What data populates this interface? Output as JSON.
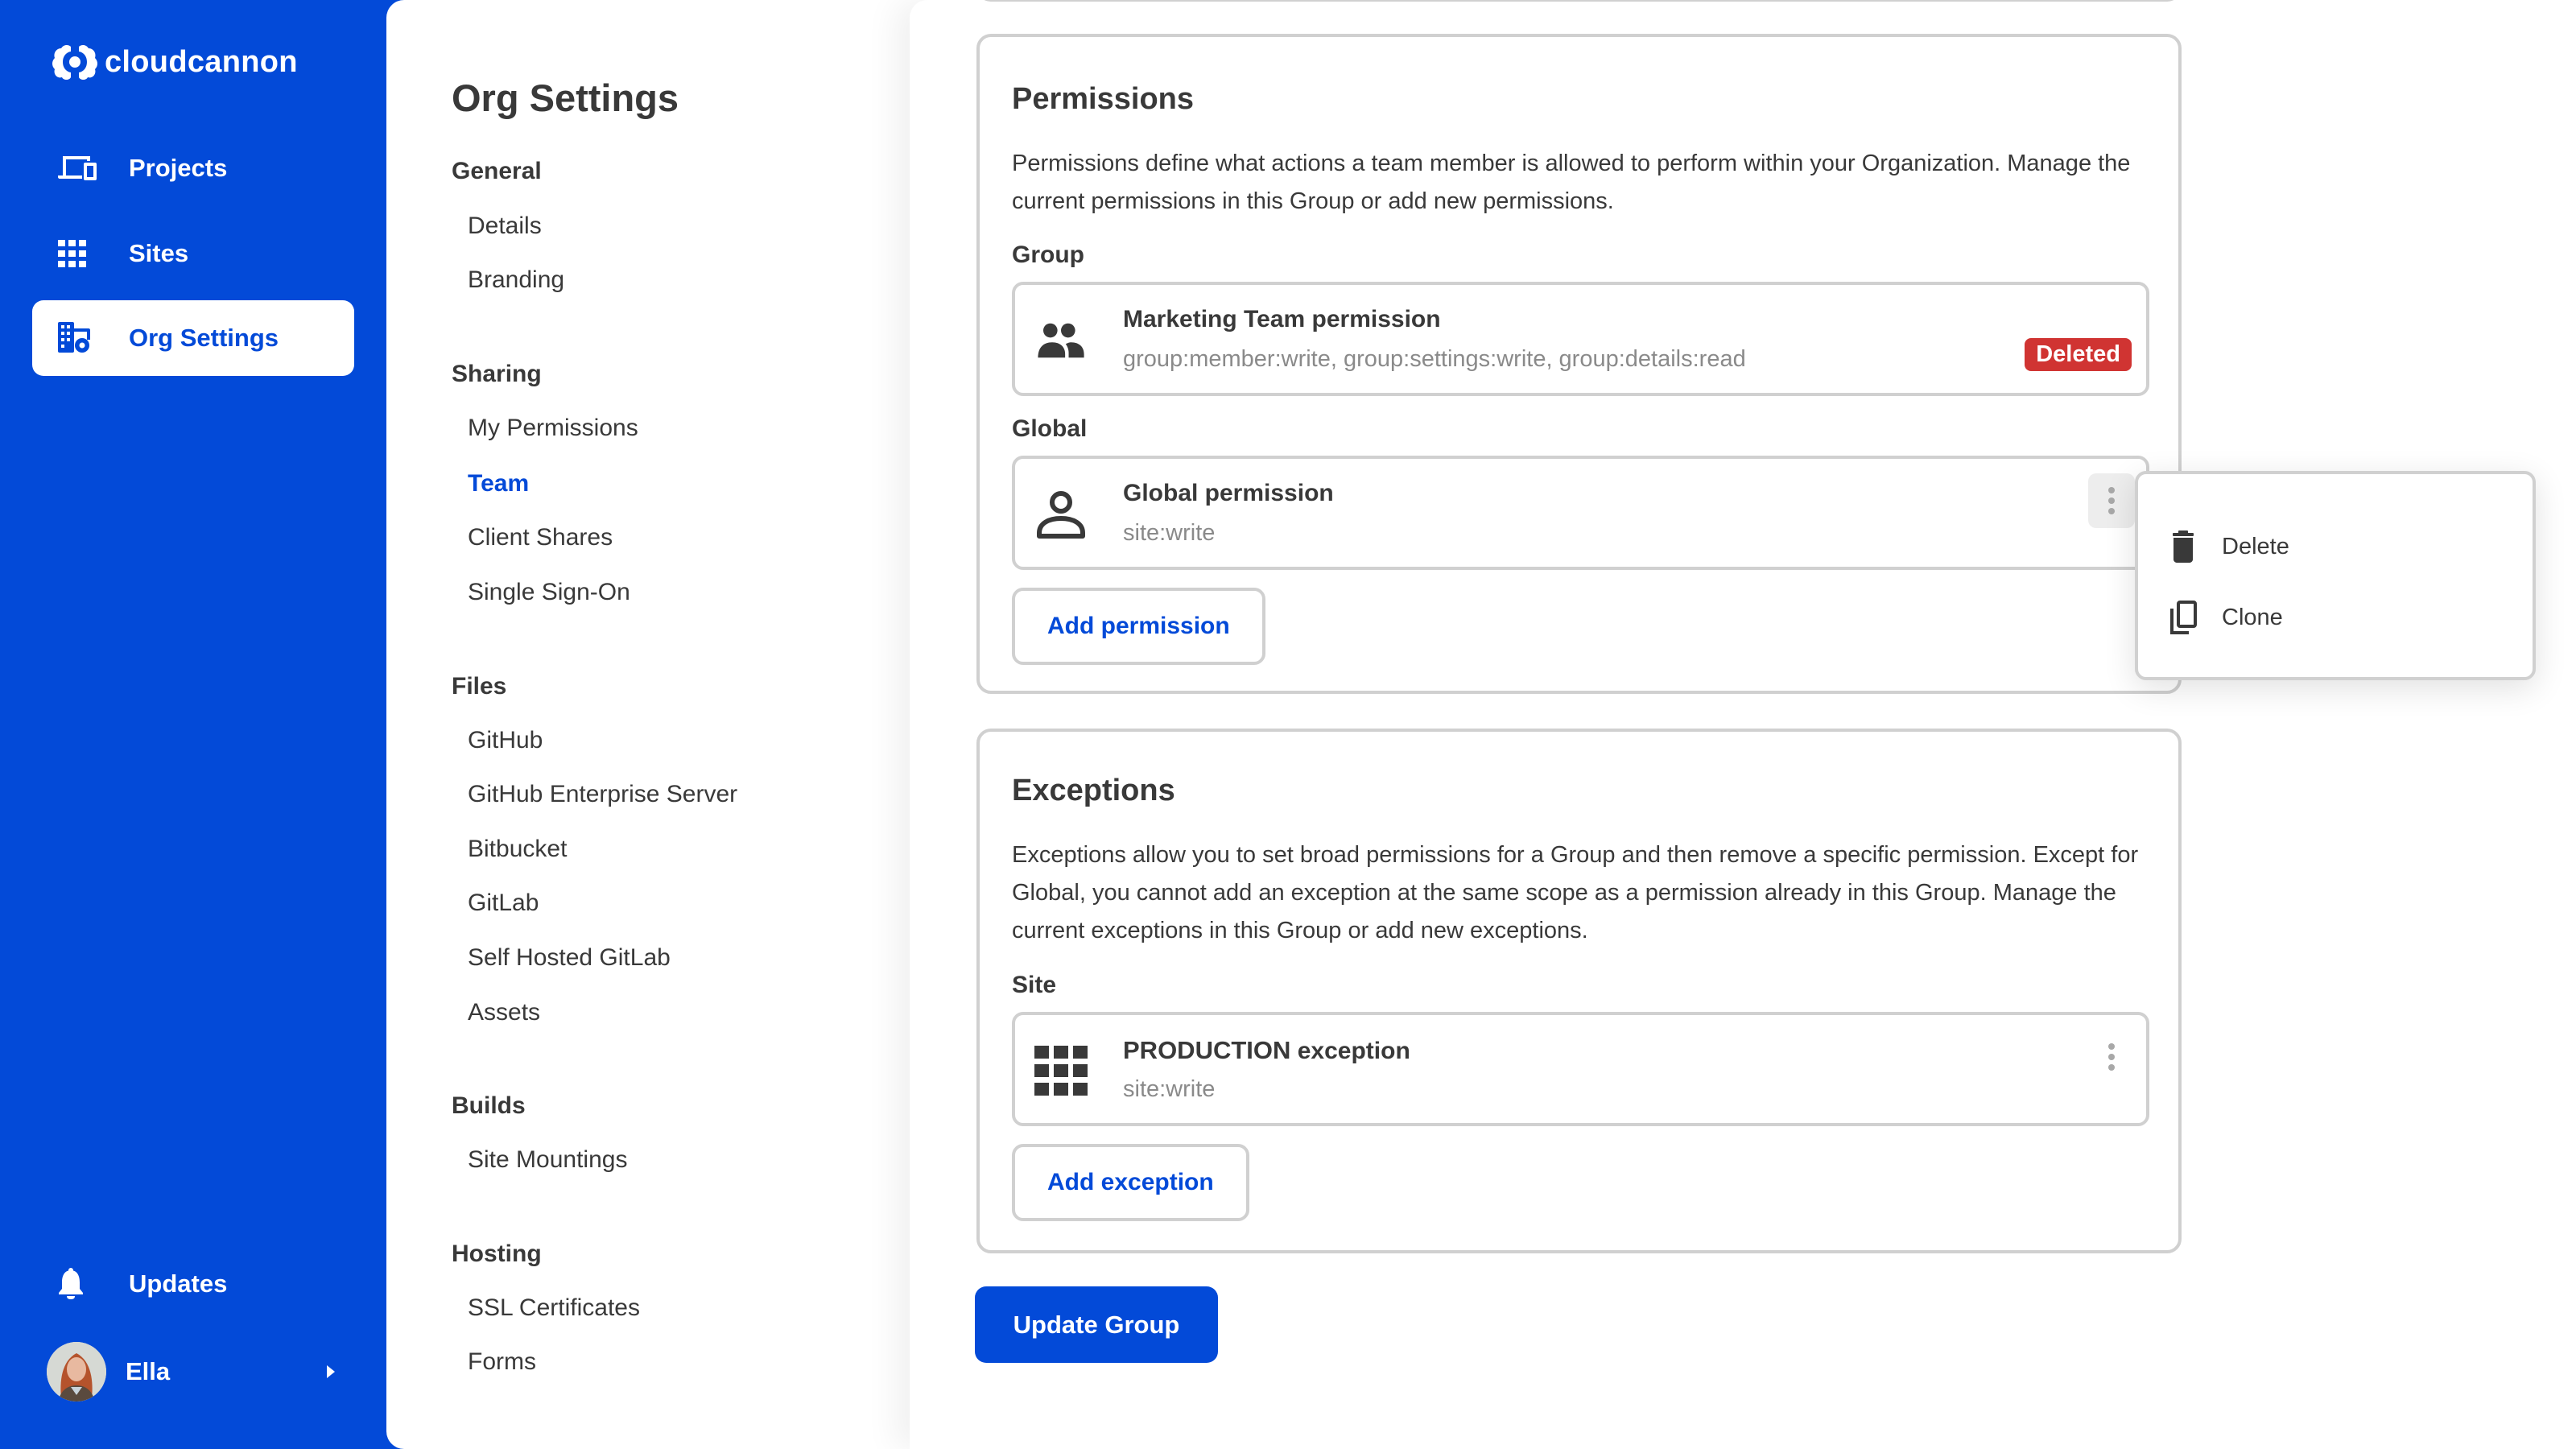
{
  "brand": {
    "name": "cloudcannon",
    "accent_color": "#034ad8",
    "danger_color": "#d03432"
  },
  "sidebar": {
    "items": [
      {
        "label": "Projects",
        "icon": "devices-icon",
        "active": false
      },
      {
        "label": "Sites",
        "icon": "grid-icon",
        "active": false
      },
      {
        "label": "Org Settings",
        "icon": "org-settings-icon",
        "active": true
      }
    ],
    "updates_label": "Updates",
    "user": {
      "name": "Ella"
    }
  },
  "settings_nav": {
    "title": "Org Settings",
    "groups": [
      {
        "heading": "General",
        "items": [
          "Details",
          "Branding"
        ]
      },
      {
        "heading": "Sharing",
        "items": [
          "My Permissions",
          "Team",
          "Client Shares",
          "Single Sign-On"
        ]
      },
      {
        "heading": "Files",
        "items": [
          "GitHub",
          "GitHub Enterprise Server",
          "Bitbucket",
          "GitLab",
          "Self Hosted GitLab",
          "Assets"
        ]
      },
      {
        "heading": "Builds",
        "items": [
          "Site Mountings"
        ]
      },
      {
        "heading": "Hosting",
        "items": [
          "SSL Certificates",
          "Forms"
        ]
      }
    ],
    "active_item": "Team"
  },
  "permissions": {
    "title": "Permissions",
    "description": "Permissions define what actions a team member is allowed to perform within your Organization. Manage the current permissions in this Group or add new permissions.",
    "group_label": "Group",
    "group_item": {
      "title": "Marketing Team permission",
      "scopes": "group:member:write, group:settings:write, group:details:read",
      "badge": "Deleted"
    },
    "global_label": "Global",
    "global_item": {
      "title": "Global permission",
      "scopes": "site:write"
    },
    "add_button": "Add permission"
  },
  "exceptions": {
    "title": "Exceptions",
    "description": "Exceptions allow you to set broad permissions for a Group and then remove a specific permission. Except for Global, you cannot add an exception at the same scope as a permission already in this Group. Manage the current exceptions in this Group or add new exceptions.",
    "site_label": "Site",
    "site_item": {
      "title_strong": "PRODUCTION",
      "title_rest": " exception",
      "scopes": "site:write"
    },
    "add_button": "Add exception"
  },
  "update_button": "Update Group",
  "context_menu": {
    "items": [
      {
        "label": "Delete",
        "icon": "trash-icon"
      },
      {
        "label": "Clone",
        "icon": "copy-icon"
      }
    ]
  }
}
